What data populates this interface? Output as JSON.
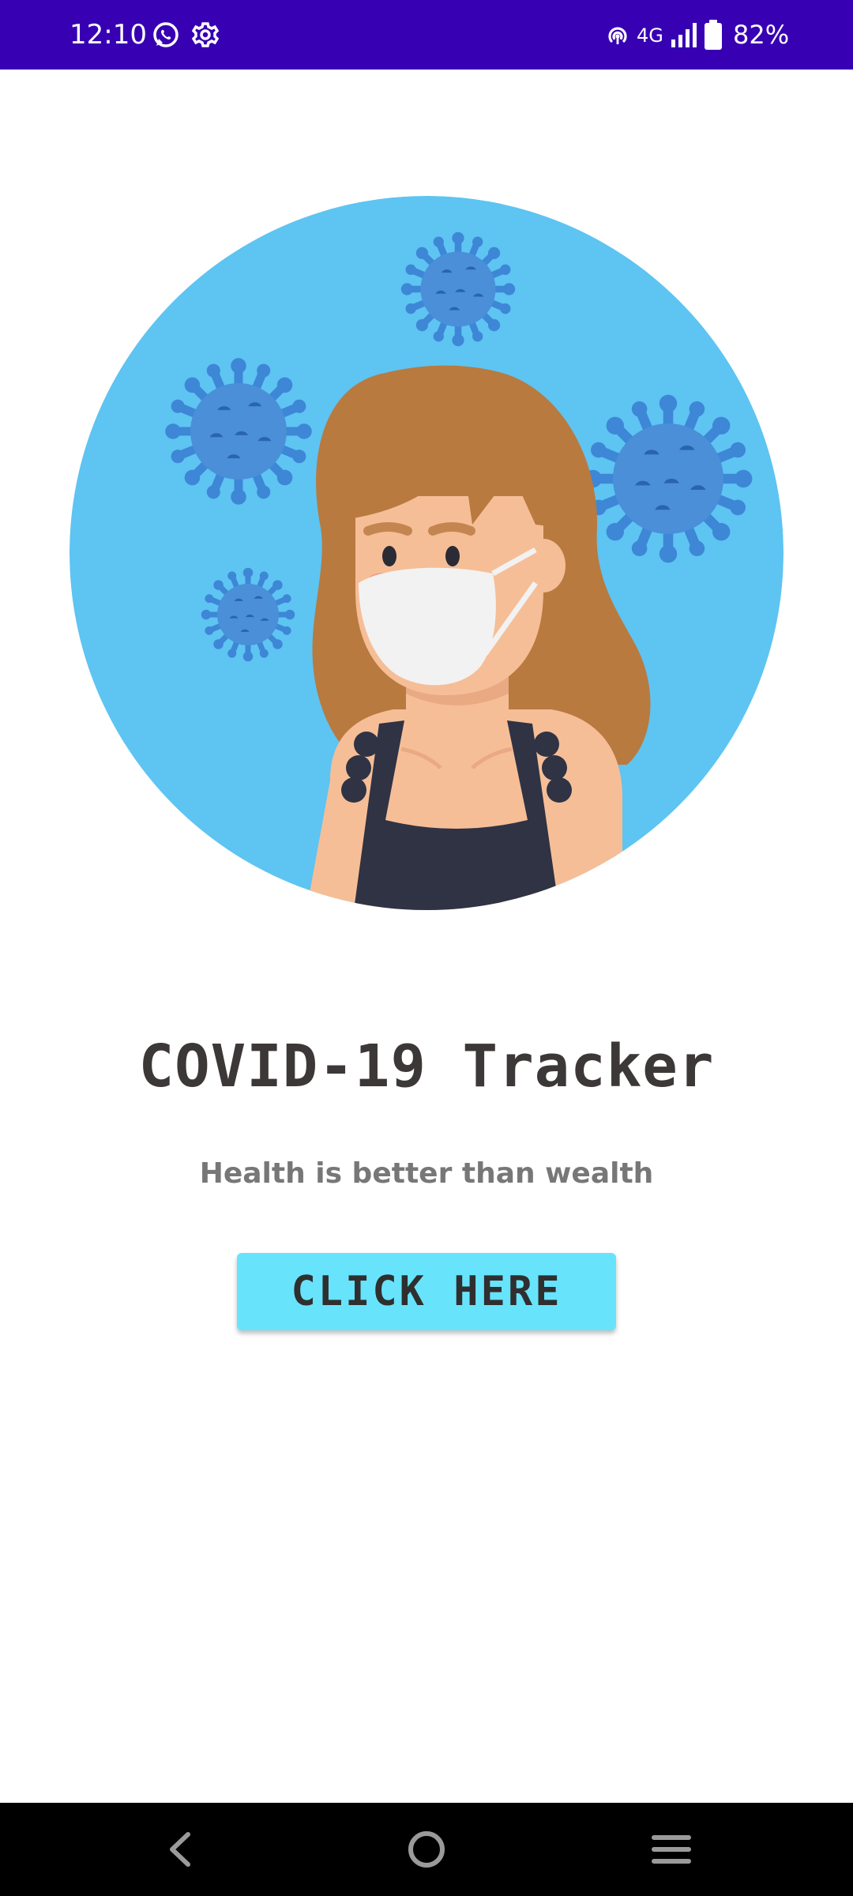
{
  "status_bar": {
    "time": "12:10",
    "network": "4G",
    "battery": "82%",
    "background_color": "#3700b3",
    "icons": [
      "whatsapp-icon",
      "settings-gear-icon",
      "hotspot-icon",
      "signal-icon",
      "battery-icon"
    ]
  },
  "hero": {
    "illustration": "woman-wearing-mask-with-virus-particles",
    "circle_color": "#5ec4f2"
  },
  "main": {
    "title": "COVID-19 Tracker",
    "subtitle": "Health is better than wealth",
    "button_label": "CLICK HERE",
    "button_color": "#67e4fc"
  },
  "nav_bar": {
    "buttons": [
      "back-icon",
      "home-icon",
      "recents-menu-icon"
    ]
  }
}
